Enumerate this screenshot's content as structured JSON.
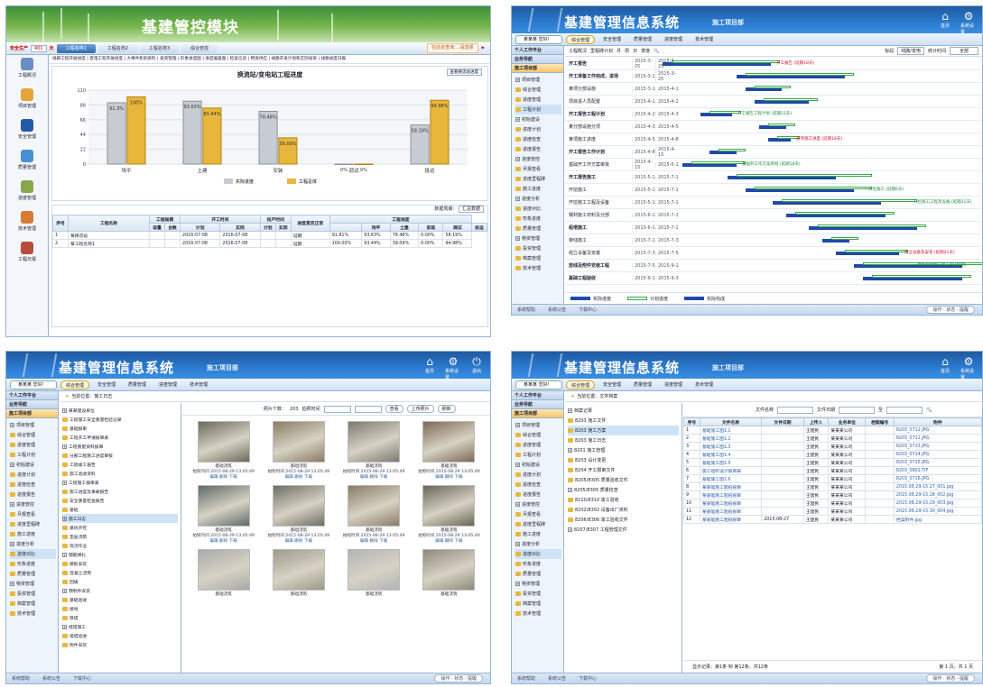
{
  "panel1": {
    "title": "基建管控模块",
    "safe_label": "安全生产",
    "safe_days": "401",
    "safe_unit": "天",
    "tabs": [
      "工程名称1",
      "工程名称2",
      "工程名称3",
      "综合管控"
    ],
    "search_label": "在此处查询... 请选择",
    "links": "线路工程开展进度 | 变电工程开展进度 | 大事件影响资料 | 投资管理 | 形象进度图 | 进度偏差图 | 检查信息 | 物资供应 | 线路开发计划和实际投资 | 线路进度日报",
    "modules": [
      "工程概况",
      "项目管理",
      "安全管理",
      "质量管理",
      "进度管理",
      "技术管理",
      "工程日报"
    ],
    "chart_title": "换流站/变电站工程进度",
    "download": "查看换流站进度",
    "legend": [
      "实际进度",
      "工程总体"
    ],
    "table_note": "数据周期：",
    "table_select": "汇总数据",
    "table_head": [
      "序号",
      "工程名称",
      "工程规模",
      "",
      "开工时间",
      "",
      "投产时间",
      "",
      "进度是否正常",
      "工程进度"
    ],
    "table_sub": [
      "容量",
      "台数",
      "计划",
      "实际",
      "计划",
      "实际",
      "",
      "场平",
      "土建",
      "安装",
      "调试",
      "投运"
    ],
    "rows": [
      [
        "1",
        "某换流站",
        "",
        "",
        "2016-07-08",
        "2016-07-08",
        "",
        "",
        "延期",
        "91.81%",
        "93.63%",
        "78.48%",
        "0.00%",
        "58.19%"
      ],
      [
        "2",
        "某工程名称1",
        "",
        "",
        "2016-07-08",
        "2016-07-08",
        "",
        "",
        "延期",
        "100.00%",
        "93.44%",
        "39.09%",
        "0.00%",
        "94.98%"
      ]
    ]
  },
  "chart_data": {
    "type": "bar",
    "title": "换流站/变电站工程进度",
    "categories": [
      "场平",
      "土建",
      "安装",
      "调试",
      "投运"
    ],
    "series": [
      {
        "name": "实际进度",
        "values": [
          91.3,
          93.63,
          78.48,
          0,
          58.19
        ]
      },
      {
        "name": "工程总体",
        "values": [
          100,
          83.44,
          39.09,
          0,
          94.98
        ]
      }
    ],
    "ylim": [
      0,
      110
    ],
    "yticks": [
      "110",
      "88",
      "66",
      "44",
      "22",
      "0"
    ],
    "labels": [
      [
        "91.3%",
        "100%"
      ],
      [
        "93.63%",
        "83.44%"
      ],
      [
        "78.48%",
        "39.09%"
      ],
      [
        "0%",
        "0%"
      ],
      [
        "58.19%",
        "94.98%"
      ]
    ],
    "xlabel": "",
    "ylabel": ""
  },
  "common": {
    "brand": "基建管理信息系统",
    "subtitle": "施工项目部",
    "user": "某某某 您好!",
    "nav": [
      "综合管理",
      "安全管理",
      "质量管理",
      "进度管理",
      "技术管理"
    ],
    "header_icons": [
      "首页",
      "系统设置",
      "退出"
    ],
    "side_top": "个人工作平台",
    "side_title": "业务导航",
    "side_section": "施工项目部",
    "status": [
      "系统帮助",
      "系统公告",
      "下载中心"
    ],
    "status_right": "操作 · 状态 · 提醒"
  },
  "panel2": {
    "tree": [
      "项目管理",
      "综合管理",
      "进度管理",
      "工程计划",
      "初始建设",
      "进度计划",
      "进度检查",
      "进度报告",
      "进度管控",
      "月报查看",
      "进度里程碑",
      "施工进度",
      "进度分析",
      "进度对比",
      "形象进度",
      "质量管理",
      "物资管理",
      "投资管理",
      "档案管理",
      "技术管理"
    ],
    "toolbar": [
      "工程概况",
      "里程碑计划",
      "月",
      "周",
      "日",
      "季度"
    ],
    "filter_label": "标段",
    "filter_value": "线路/变电",
    "period_label": "统计时间",
    "period_value": "全部",
    "rows": [
      {
        "n": "开工报告",
        "d1": "2015-3-25",
        "d2": "2015-3-25",
        "bold": true
      },
      {
        "n": "开工准备工作完成，进场",
        "d1": "2015-3-1",
        "d2": "2015-3-25",
        "bold": true
      },
      {
        "n": "某项分部设施",
        "d1": "2015-3-1",
        "d2": "2015-4-1",
        "bold": false
      },
      {
        "n": "项目进人员配置",
        "d1": "2015-4-1",
        "d2": "2015-4-2",
        "bold": false
      },
      {
        "n": "开工报告工程计划",
        "d1": "2015-4-2",
        "d2": "2015-4-3",
        "bold": true
      },
      {
        "n": "某分部设施分项",
        "d1": "2015-4-3",
        "d2": "2015-4-5",
        "bold": false
      },
      {
        "n": "某项施工进度",
        "d1": "2015-4-5",
        "d2": "2015-4-8",
        "bold": false
      },
      {
        "n": "开工报告工作计划",
        "d1": "2015-4-8",
        "d2": "2015-4-15",
        "bold": true
      },
      {
        "n": "基础开工作方案审批",
        "d1": "2015-4-15",
        "d2": "2015-5-1",
        "bold": false
      },
      {
        "n": "开工报告施工",
        "d1": "2015-5-1",
        "d2": "2015-7-1",
        "bold": true
      },
      {
        "n": "开挖施工",
        "d1": "2015-5-1",
        "d2": "2015-7-1",
        "bold": false
      },
      {
        "n": "开挖施工工程及设备",
        "d1": "2015-5-1",
        "d2": "2015-7-1",
        "bold": false
      },
      {
        "n": "钢材施工材料及分部",
        "d1": "2015-6-1",
        "d2": "2015-7-1",
        "bold": false
      },
      {
        "n": "组塔施工",
        "d1": "2015-6-1",
        "d2": "2015-7-1",
        "bold": true
      },
      {
        "n": "架线施工",
        "d1": "2015-7-1",
        "d2": "2015-7-3",
        "bold": false
      },
      {
        "n": "组立设备及安装",
        "d1": "2015-7-3",
        "d2": "2015-7-5",
        "bold": false
      },
      {
        "n": "放线及附件安装工程",
        "d1": "2015-7-5",
        "d2": "2015-9-1",
        "bold": true
      },
      {
        "n": "基础工程验收",
        "d1": "2015-9-1",
        "d2": "2015-9-3",
        "bold": true
      }
    ],
    "annotations": [
      "开工报告 (延期18天)",
      "开工报告工程计划 (延期12天)",
      "某项施工进度 (延期18天)",
      "基础开工作方案审批 (延期18天)",
      "开挖施工 (延期6天)",
      "开挖施工工程及设备 (延期21天)",
      "组立设备及安装 (延期21天)",
      "放线及附件安装工程 (延期)"
    ],
    "legend": [
      "实际进度",
      "计划进度",
      "实际完成"
    ]
  },
  "panel3": {
    "breadcrumb": "当前位置：施工日志",
    "tree": [
      "某某建设单位",
      "工程施工安全质量检验记录",
      "基础报审",
      "工程开工申请报审表",
      "工程质量资料报审",
      "分部工程施工进度审核",
      "工程竣工报告",
      "施工验收资料",
      "工程施工报审表",
      "施工进度及事故报告",
      "安全质量检查报告",
      "基础",
      "施工日志",
      "基坑开挖",
      "垫层浇筑",
      "现浇作业",
      "钢筋绑扎",
      "模板安装",
      "混凝土浇筑",
      "回填",
      "预制件安装",
      "基础验收",
      "接地",
      "铁塔",
      "组塔施工",
      "组塔验收",
      "附件安装"
    ],
    "tool_label": "照片个数：",
    "tool_count": "203",
    "tool_date": "拍照时间",
    "tool_btns": [
      "查看",
      "上传照片",
      "刷新"
    ],
    "photos": [
      {
        "cap": "基础浇筑",
        "meta": "拍照时间 2015-08-29 13:05:49",
        "acts": "编辑 删除 下载"
      },
      {
        "cap": "基础浇筑",
        "meta": "拍照时间 2015-08-29 13:05:49",
        "acts": "编辑 删除 下载"
      },
      {
        "cap": "基础浇筑",
        "meta": "拍照时间 2015-08-29 13:05:49",
        "acts": "编辑 删除 下载"
      },
      {
        "cap": "基础浇筑",
        "meta": "拍照时间 2015-08-29 13:05:49",
        "acts": "编辑 删除 下载"
      },
      {
        "cap": "基础浇筑",
        "meta": "拍照时间 2015-08-29 13:05:49",
        "acts": "编辑 删除 下载"
      },
      {
        "cap": "基础浇筑",
        "meta": "拍照时间 2015-08-29 13:05:49",
        "acts": "编辑 删除 下载"
      },
      {
        "cap": "基础浇筑",
        "meta": "拍照时间 2015-08-29 13:05:49",
        "acts": "编辑 删除 下载"
      },
      {
        "cap": "基础浇筑",
        "meta": "拍照时间 2015-08-29 13:05:49",
        "acts": "编辑 删除 下载"
      },
      {
        "cap": "基础浇筑",
        "meta": "",
        "acts": ""
      },
      {
        "cap": "基础浇筑",
        "meta": "",
        "acts": ""
      },
      {
        "cap": "基础浇筑",
        "meta": "",
        "acts": ""
      },
      {
        "cap": "基础浇筑",
        "meta": "",
        "acts": ""
      }
    ],
    "photo_colors": [
      "#6b6a5c",
      "#8a7d63",
      "#7d7a70",
      "#7e6a55",
      "#5e6b6a",
      "#6f6f65",
      "#8a7c66",
      "#6a6757",
      "#a8a9a8",
      "#9d9a8a",
      "#b2b4b7",
      "#8f8a7b"
    ]
  },
  "panel4": {
    "breadcrumb": "当前位置：文件档案",
    "tree": [
      "档案记录",
      "8203 施工文件",
      "8203 施工方案",
      "8203 施工日志",
      "8201 施工管理",
      "8203 设计变更",
      "8204 开工报审文件",
      "8205/8305 质量验收文件",
      "8205/8305 质量检查",
      "8210/8310 竣工验收",
      "8202/8302 设备出厂资料",
      "8206/8306 竣工验收文件",
      "8207/8307 工程管理文件"
    ],
    "filter": [
      "文件名称",
      "文件日期",
      "至"
    ],
    "head": [
      "序号",
      "文件名称",
      "文件日期",
      "上传人",
      "业务单位",
      "档案编号",
      "附件"
    ],
    "rows": [
      [
        "1",
        "基础施工图1.1",
        "",
        "王建民",
        "某某某公司",
        "",
        "8203_0711.JPG"
      ],
      [
        "2",
        "基础施工图1.2",
        "",
        "王建民",
        "某某某公司",
        "",
        "8203_0712.JPG"
      ],
      [
        "3",
        "基础施工图1.3",
        "",
        "王建民",
        "某某某公司",
        "",
        "8203_0713.JPG"
      ],
      [
        "4",
        "基础施工图1.4",
        "",
        "王建民",
        "某某某公司",
        "",
        "8203_0714.JPG"
      ],
      [
        "5",
        "基础施工图1.5",
        "",
        "王建民",
        "某某某公司",
        "",
        "8203_0715.JPG"
      ],
      [
        "6",
        "施工组织设计报审表",
        "",
        "王建民",
        "某某某公司",
        "",
        "8203_0801.TIF"
      ],
      [
        "7",
        "基础施工图1.6",
        "",
        "王建民",
        "某某某公司",
        "",
        "8203_0716.JPG"
      ],
      [
        "8",
        "某基础施工图纸报审",
        "",
        "王建民",
        "某某某公司",
        "",
        "2015.08.29-15.27_001.jpg"
      ],
      [
        "9",
        "某基础施工图纸报审",
        "",
        "王建民",
        "某某某公司",
        "",
        "2015.08.29-15.28_002.jpg"
      ],
      [
        "10",
        "某基础施工图纸报审",
        "",
        "王建民",
        "某某某公司",
        "",
        "2015.08.29-15.29_003.jpg"
      ],
      [
        "11",
        "某基础施工图纸报审",
        "",
        "王建民",
        "某某某公司",
        "",
        "2015.08.29-15.30_004.jpg"
      ],
      [
        "12",
        "某基础施工图纸报审",
        "2015-08-27",
        "王建民",
        "某某某公司",
        "",
        "档案附件.jpg"
      ]
    ],
    "pager_left": "显示记录：第1条 到 第12条，共12条",
    "pager_right": "第 1 页，共 1 页"
  }
}
